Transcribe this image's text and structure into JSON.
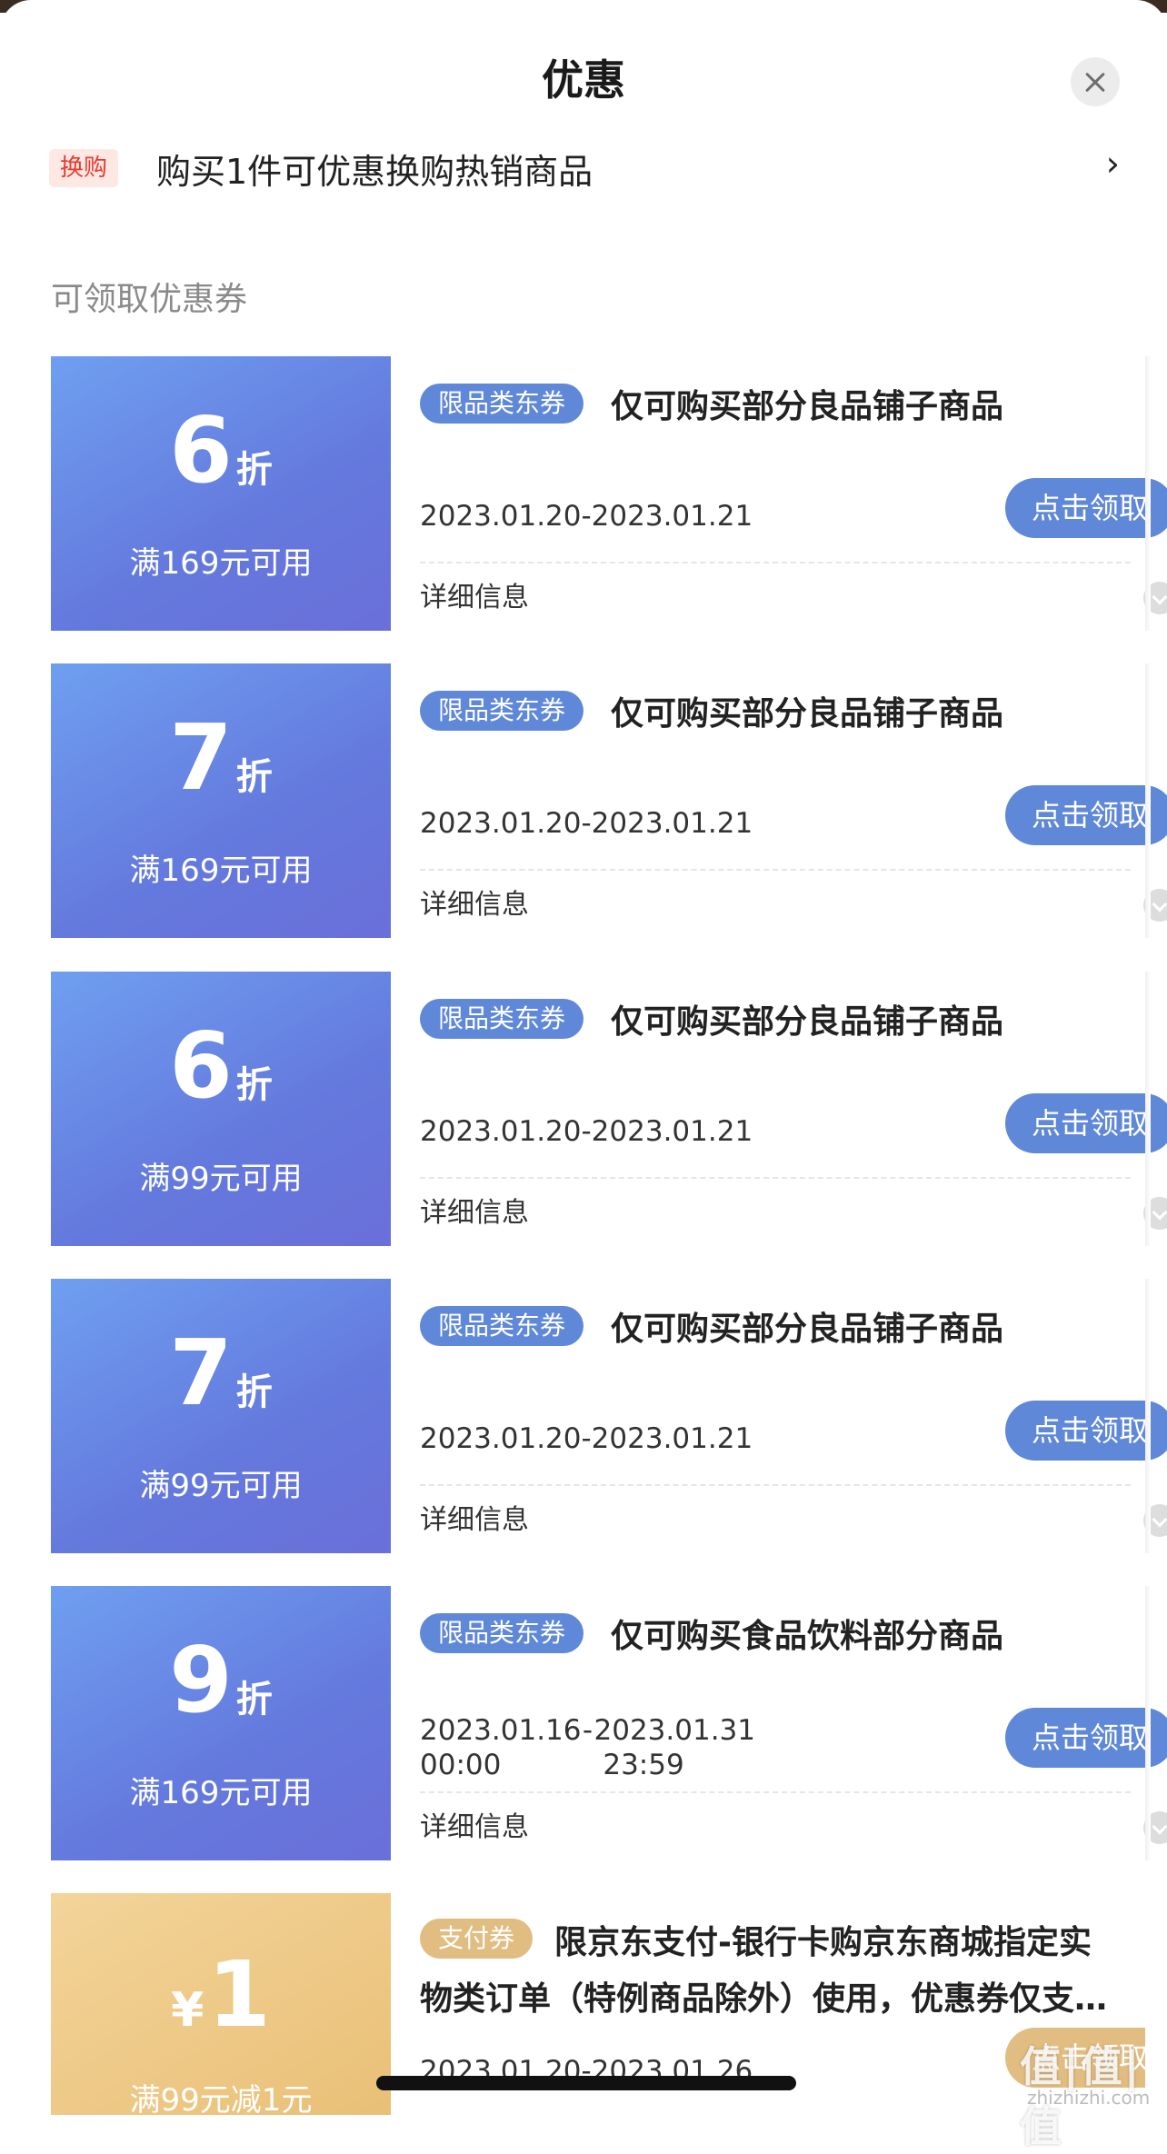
{
  "header": {
    "title": "优惠"
  },
  "swap": {
    "tag": "换购",
    "text": "购买1件可优惠换购热销商品",
    "chevron": "›"
  },
  "section_title": "可领取优惠券",
  "coupons": [
    {
      "value": "6",
      "unit": "折",
      "condition": "满169元可用",
      "tag": "限品类东券",
      "desc": "仅可购买部分良品铺子商品",
      "date": "2023.01.20-2023.01.21",
      "button": "点击领取",
      "detail": "详细信息"
    },
    {
      "value": "7",
      "unit": "折",
      "condition": "满169元可用",
      "tag": "限品类东券",
      "desc": "仅可购买部分良品铺子商品",
      "date": "2023.01.20-2023.01.21",
      "button": "点击领取",
      "detail": "详细信息"
    },
    {
      "value": "6",
      "unit": "折",
      "condition": "满99元可用",
      "tag": "限品类东券",
      "desc": "仅可购买部分良品铺子商品",
      "date": "2023.01.20-2023.01.21",
      "button": "点击领取",
      "detail": "详细信息"
    },
    {
      "value": "7",
      "unit": "折",
      "condition": "满99元可用",
      "tag": "限品类东券",
      "desc": "仅可购买部分良品铺子商品",
      "date": "2023.01.20-2023.01.21",
      "button": "点击领取",
      "detail": "详细信息"
    },
    {
      "value": "9",
      "unit": "折",
      "condition": "满169元可用",
      "tag": "限品类东券",
      "desc": "仅可购买食品饮料部分商品",
      "date_start": "2023.01.16",
      "date_start_time": "00:00",
      "date_sep": "-",
      "date_end": "2023.01.31",
      "date_end_time": "23:59",
      "button": "点击领取",
      "detail": "详细信息"
    },
    {
      "currency": "¥",
      "value": "1",
      "condition": "满99元减1元",
      "tag": "支付券",
      "desc_line1": "限京东支付-银行卡购京东商城指定实",
      "desc_line2": "物类订单（特例商品除外）使用，优惠券仅支…",
      "date": "2023.01.20-2023.01.26",
      "button": "点击领取"
    }
  ],
  "watermark": {
    "text": "值|值|值",
    "sub": "zhizhizhi.com"
  },
  "colors": {
    "coupon_blue": "#6479dd",
    "tag_blue": "#5f88d9",
    "coupon_gold": "#e8bd72",
    "swap_tag_red": "#e83a2f"
  },
  "icons": {
    "close": "close-icon",
    "chevron": "chevron-right-icon",
    "expand": "chevron-down-icon"
  }
}
